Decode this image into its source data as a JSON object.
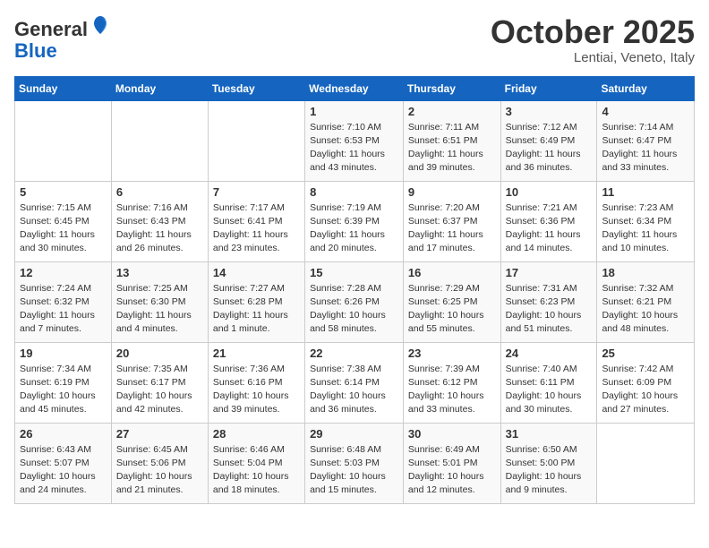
{
  "header": {
    "logo_general": "General",
    "logo_blue": "Blue",
    "month": "October 2025",
    "location": "Lentiai, Veneto, Italy"
  },
  "days_of_week": [
    "Sunday",
    "Monday",
    "Tuesday",
    "Wednesday",
    "Thursday",
    "Friday",
    "Saturday"
  ],
  "weeks": [
    [
      {
        "day": "",
        "info": ""
      },
      {
        "day": "",
        "info": ""
      },
      {
        "day": "",
        "info": ""
      },
      {
        "day": "1",
        "info": "Sunrise: 7:10 AM\nSunset: 6:53 PM\nDaylight: 11 hours\nand 43 minutes."
      },
      {
        "day": "2",
        "info": "Sunrise: 7:11 AM\nSunset: 6:51 PM\nDaylight: 11 hours\nand 39 minutes."
      },
      {
        "day": "3",
        "info": "Sunrise: 7:12 AM\nSunset: 6:49 PM\nDaylight: 11 hours\nand 36 minutes."
      },
      {
        "day": "4",
        "info": "Sunrise: 7:14 AM\nSunset: 6:47 PM\nDaylight: 11 hours\nand 33 minutes."
      }
    ],
    [
      {
        "day": "5",
        "info": "Sunrise: 7:15 AM\nSunset: 6:45 PM\nDaylight: 11 hours\nand 30 minutes."
      },
      {
        "day": "6",
        "info": "Sunrise: 7:16 AM\nSunset: 6:43 PM\nDaylight: 11 hours\nand 26 minutes."
      },
      {
        "day": "7",
        "info": "Sunrise: 7:17 AM\nSunset: 6:41 PM\nDaylight: 11 hours\nand 23 minutes."
      },
      {
        "day": "8",
        "info": "Sunrise: 7:19 AM\nSunset: 6:39 PM\nDaylight: 11 hours\nand 20 minutes."
      },
      {
        "day": "9",
        "info": "Sunrise: 7:20 AM\nSunset: 6:37 PM\nDaylight: 11 hours\nand 17 minutes."
      },
      {
        "day": "10",
        "info": "Sunrise: 7:21 AM\nSunset: 6:36 PM\nDaylight: 11 hours\nand 14 minutes."
      },
      {
        "day": "11",
        "info": "Sunrise: 7:23 AM\nSunset: 6:34 PM\nDaylight: 11 hours\nand 10 minutes."
      }
    ],
    [
      {
        "day": "12",
        "info": "Sunrise: 7:24 AM\nSunset: 6:32 PM\nDaylight: 11 hours\nand 7 minutes."
      },
      {
        "day": "13",
        "info": "Sunrise: 7:25 AM\nSunset: 6:30 PM\nDaylight: 11 hours\nand 4 minutes."
      },
      {
        "day": "14",
        "info": "Sunrise: 7:27 AM\nSunset: 6:28 PM\nDaylight: 11 hours\nand 1 minute."
      },
      {
        "day": "15",
        "info": "Sunrise: 7:28 AM\nSunset: 6:26 PM\nDaylight: 10 hours\nand 58 minutes."
      },
      {
        "day": "16",
        "info": "Sunrise: 7:29 AM\nSunset: 6:25 PM\nDaylight: 10 hours\nand 55 minutes."
      },
      {
        "day": "17",
        "info": "Sunrise: 7:31 AM\nSunset: 6:23 PM\nDaylight: 10 hours\nand 51 minutes."
      },
      {
        "day": "18",
        "info": "Sunrise: 7:32 AM\nSunset: 6:21 PM\nDaylight: 10 hours\nand 48 minutes."
      }
    ],
    [
      {
        "day": "19",
        "info": "Sunrise: 7:34 AM\nSunset: 6:19 PM\nDaylight: 10 hours\nand 45 minutes."
      },
      {
        "day": "20",
        "info": "Sunrise: 7:35 AM\nSunset: 6:17 PM\nDaylight: 10 hours\nand 42 minutes."
      },
      {
        "day": "21",
        "info": "Sunrise: 7:36 AM\nSunset: 6:16 PM\nDaylight: 10 hours\nand 39 minutes."
      },
      {
        "day": "22",
        "info": "Sunrise: 7:38 AM\nSunset: 6:14 PM\nDaylight: 10 hours\nand 36 minutes."
      },
      {
        "day": "23",
        "info": "Sunrise: 7:39 AM\nSunset: 6:12 PM\nDaylight: 10 hours\nand 33 minutes."
      },
      {
        "day": "24",
        "info": "Sunrise: 7:40 AM\nSunset: 6:11 PM\nDaylight: 10 hours\nand 30 minutes."
      },
      {
        "day": "25",
        "info": "Sunrise: 7:42 AM\nSunset: 6:09 PM\nDaylight: 10 hours\nand 27 minutes."
      }
    ],
    [
      {
        "day": "26",
        "info": "Sunrise: 6:43 AM\nSunset: 5:07 PM\nDaylight: 10 hours\nand 24 minutes."
      },
      {
        "day": "27",
        "info": "Sunrise: 6:45 AM\nSunset: 5:06 PM\nDaylight: 10 hours\nand 21 minutes."
      },
      {
        "day": "28",
        "info": "Sunrise: 6:46 AM\nSunset: 5:04 PM\nDaylight: 10 hours\nand 18 minutes."
      },
      {
        "day": "29",
        "info": "Sunrise: 6:48 AM\nSunset: 5:03 PM\nDaylight: 10 hours\nand 15 minutes."
      },
      {
        "day": "30",
        "info": "Sunrise: 6:49 AM\nSunset: 5:01 PM\nDaylight: 10 hours\nand 12 minutes."
      },
      {
        "day": "31",
        "info": "Sunrise: 6:50 AM\nSunset: 5:00 PM\nDaylight: 10 hours\nand 9 minutes."
      },
      {
        "day": "",
        "info": ""
      }
    ]
  ]
}
